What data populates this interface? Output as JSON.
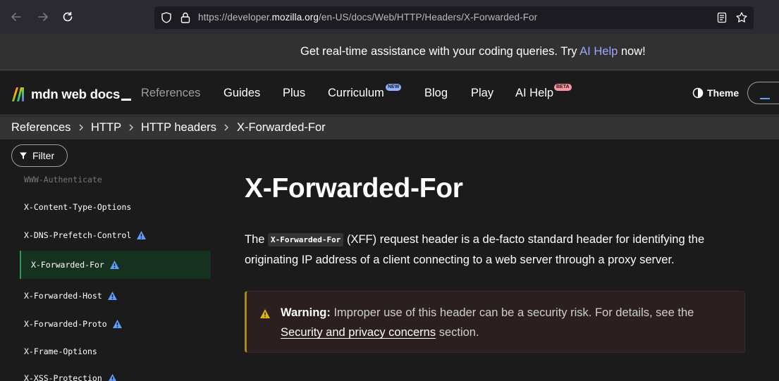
{
  "browser": {
    "url_prefix": "https://developer.",
    "url_host": "mozilla.org",
    "url_path": "/en-US/docs/Web/HTTP/Headers/X-Forwarded-For"
  },
  "banner": {
    "text_before": "Get real-time assistance with your coding queries. Try ",
    "link": "AI Help",
    "text_after": " now!"
  },
  "header": {
    "logo_text": "mdn web docs",
    "nav": [
      {
        "label": "References"
      },
      {
        "label": "Guides"
      },
      {
        "label": "Plus"
      },
      {
        "label": "Curriculum",
        "badge": "NEW"
      },
      {
        "label": "Blog"
      },
      {
        "label": "Play"
      },
      {
        "label": "AI Help",
        "badge": "BETA"
      }
    ],
    "theme_label": "Theme"
  },
  "breadcrumbs": [
    "References",
    "HTTP",
    "HTTP headers",
    "X-Forwarded-For"
  ],
  "sidebar": {
    "filter_label": "Filter",
    "items": [
      {
        "label": "WWW-Authenticate"
      },
      {
        "label": "X-Content-Type-Options"
      },
      {
        "label": "X-DNS-Prefetch-Control"
      },
      {
        "label": "X-Forwarded-For"
      },
      {
        "label": "X-Forwarded-Host"
      },
      {
        "label": "X-Forwarded-Proto"
      },
      {
        "label": "X-Frame-Options"
      },
      {
        "label": "X-XSS-Protection"
      }
    ]
  },
  "main": {
    "title": "X-Forwarded-For",
    "intro_prefix": "The ",
    "intro_code": "X-Forwarded-For",
    "intro_suffix": " (XFF) request header is a de-facto standard header for identifying the originating IP address of a client connecting to a web server through a proxy server.",
    "warning_label": "Warning:",
    "warning_text": " Improper use of this header can be a security risk. For details, see the ",
    "warning_link": "Security and privacy concerns",
    "warning_after": " section."
  },
  "colors": {
    "accent_link": "#a0a6ff",
    "active_bg": "#163120",
    "warning_border": "#a58b14",
    "warn_icon_blue": "#5e9eff",
    "warn_icon_yellow": "#d8b617"
  }
}
